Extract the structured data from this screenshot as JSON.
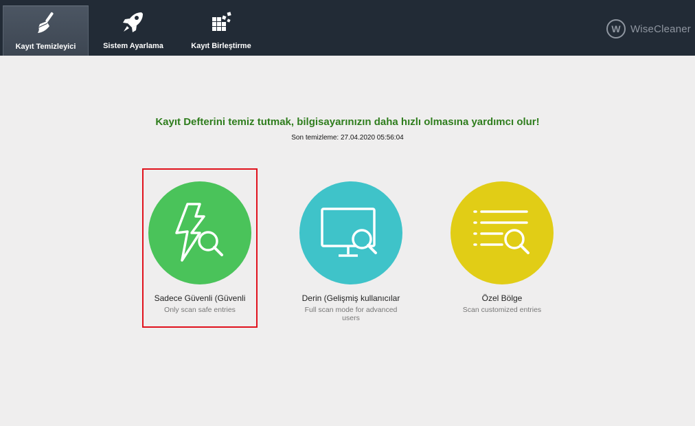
{
  "tabs": [
    {
      "label": "Kayıt Temizleyici",
      "icon": "broom-icon",
      "active": true
    },
    {
      "label": "Sistem Ayarlama",
      "icon": "rocket-icon",
      "active": false
    },
    {
      "label": "Kayıt Birleştirme",
      "icon": "defrag-blocks-icon",
      "active": false
    }
  ],
  "brand": {
    "name": "WiseCleaner",
    "mark": "W"
  },
  "main": {
    "headline": "Kayıt Defterini temiz tutmak, bilgisayarınızın daha hızlı olmasına yardımcı olur!",
    "last_clean": "Son temizleme: 27.04.2020 05:56:04"
  },
  "modes": [
    {
      "title": "Sadece Güvenli (Güvenli",
      "desc": "Only scan safe entries",
      "color": "#4ac35a",
      "icon": "lightning-search-icon",
      "selected": true
    },
    {
      "title": "Derin (Gelişmiş kullanıcılar",
      "desc": "Full scan mode for advanced users",
      "color": "#3fc3c9",
      "icon": "monitor-search-icon",
      "selected": false
    },
    {
      "title": "Özel Bölge",
      "desc": "Scan customized entries",
      "color": "#e1cd16",
      "icon": "list-search-icon",
      "selected": false
    }
  ],
  "colors": {
    "topbar": "#222b36",
    "background": "#efeeee",
    "headline": "#2f7d1d",
    "selection": "#e0111c"
  }
}
